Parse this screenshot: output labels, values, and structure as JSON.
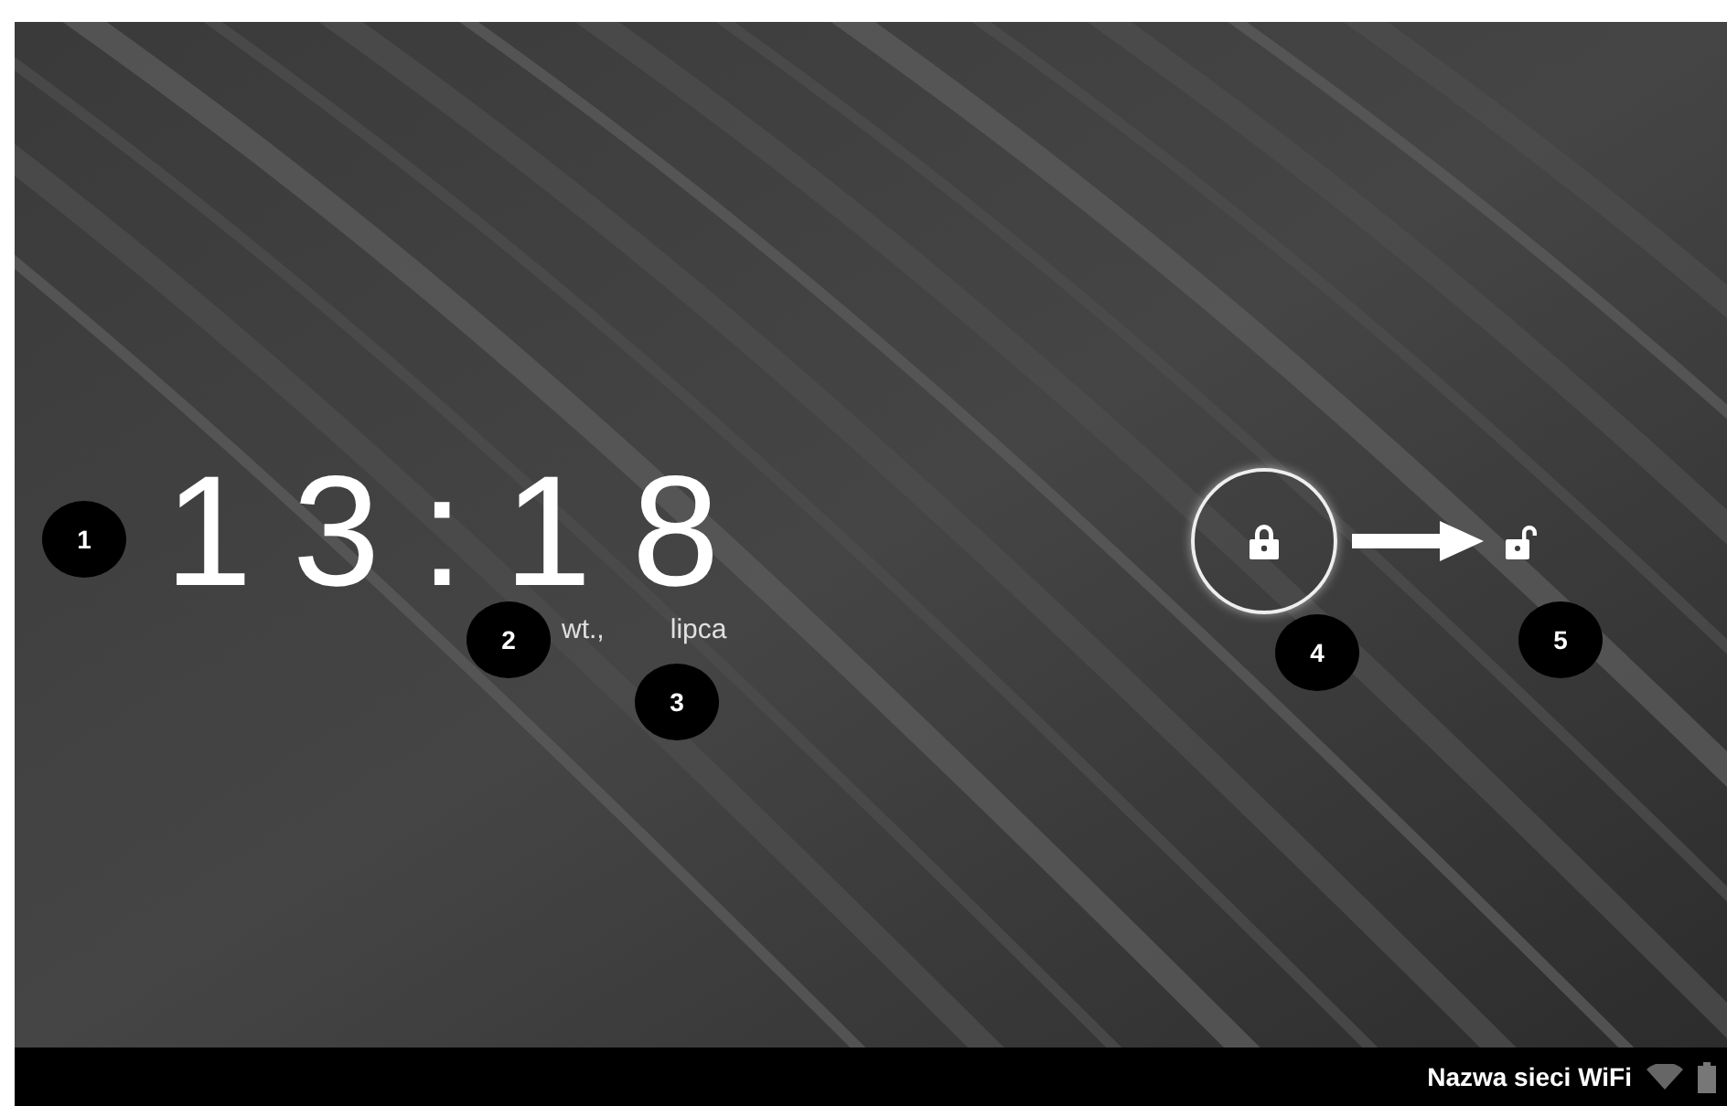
{
  "clock": {
    "time": "13:18",
    "day": "wt.,",
    "month": "lipca"
  },
  "annotations": [
    "1",
    "2",
    "3",
    "4",
    "5"
  ],
  "status_bar": {
    "network_name": "Nazwa sieci WiFi"
  }
}
